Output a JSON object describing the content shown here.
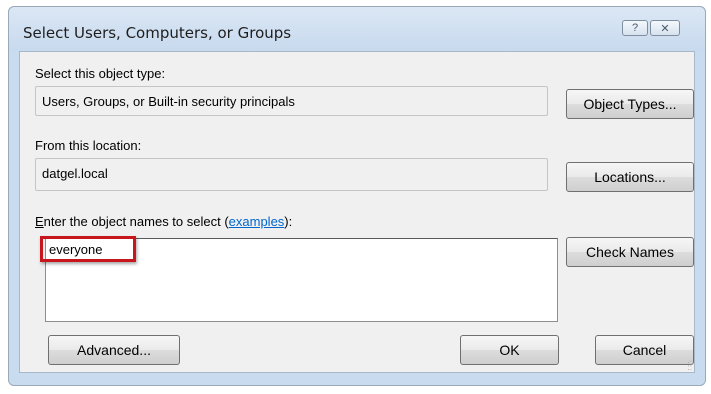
{
  "window": {
    "title": "Select Users, Computers, or Groups",
    "help_glyph": "?",
    "close_glyph": "✕"
  },
  "object_type": {
    "label": "Select this object type:",
    "value": "Users, Groups, or Built-in security principals",
    "button": "Object Types..."
  },
  "location": {
    "label": "From this location:",
    "value": "datgel.local",
    "button": "Locations..."
  },
  "names": {
    "label_prefix_accel": "E",
    "label_prefix": "nter the object names to select (",
    "link": "examples",
    "label_suffix": "):",
    "value": "everyone",
    "button": "Check Names"
  },
  "footer": {
    "advanced": "Advanced...",
    "ok": "OK",
    "cancel": "Cancel"
  },
  "colors": {
    "highlight": "#c8161d",
    "link": "#0066cc",
    "frame": "#c9dbee"
  }
}
